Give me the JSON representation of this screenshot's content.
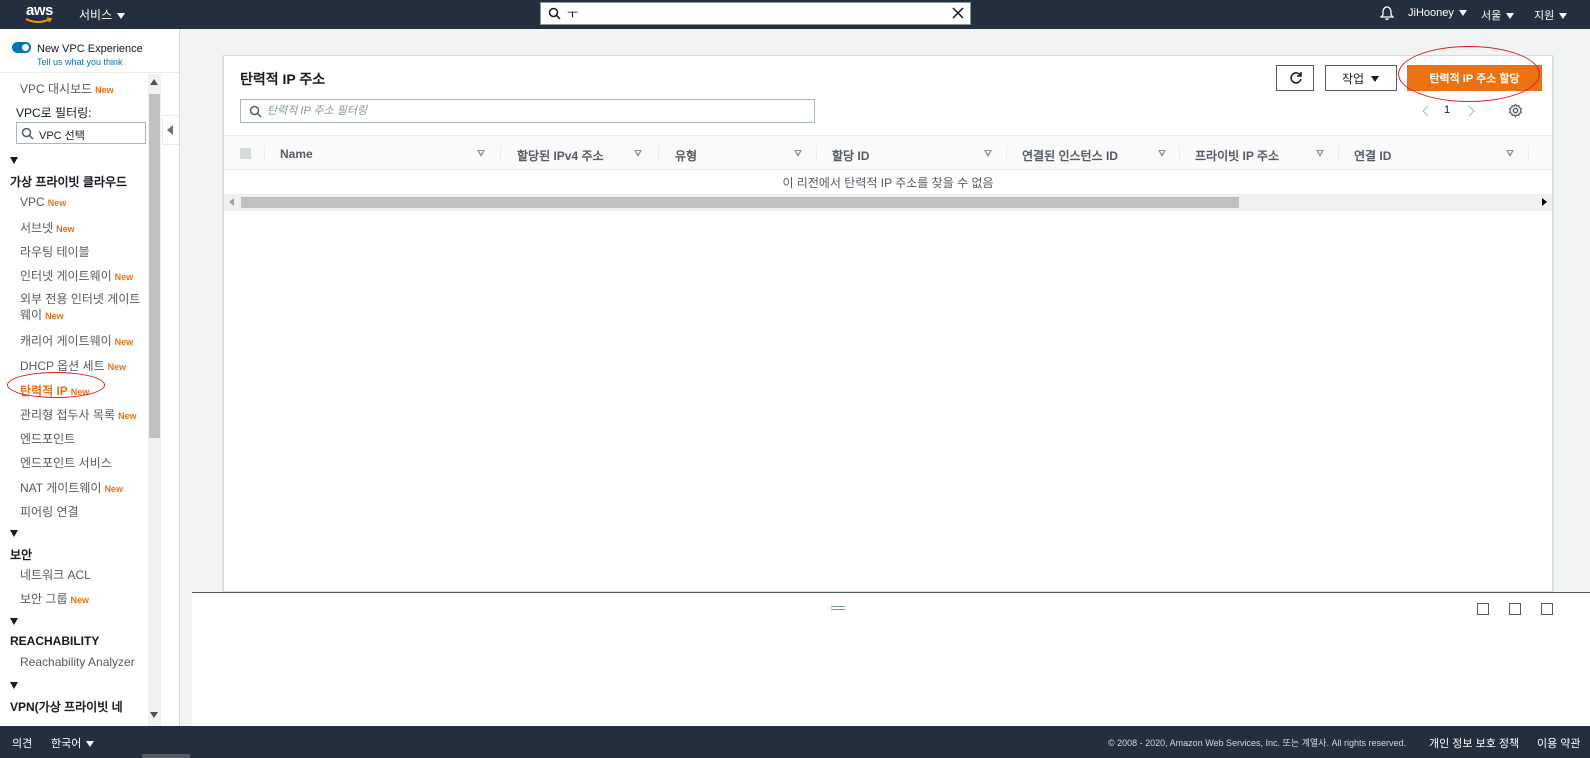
{
  "topnav": {
    "logo": "aws",
    "services": "서비스",
    "search_value": "ㅜ",
    "user": "JiHooney",
    "region": "서울",
    "support": "지원"
  },
  "sidebar": {
    "new_vpc_experience": "New VPC Experience",
    "tell_us": "Tell us what you think",
    "dashboard": "VPC 대시보드",
    "filter_label": "VPC로 필터링:",
    "filter_select": "VPC 선택",
    "new_badge": "New",
    "sections": [
      {
        "title": "가상 프라이빗 클라우드",
        "items": [
          {
            "label": "VPC",
            "new": true
          },
          {
            "label": "서브넷",
            "new": true
          },
          {
            "label": "라우팅 테이블",
            "new": false
          },
          {
            "label": "인터넷 게이트웨이",
            "new": true
          },
          {
            "label": "외부 전용 인터넷 게이트",
            "label2": "웨이",
            "new": true
          },
          {
            "label": "캐리어 게이트웨이",
            "new": true
          },
          {
            "label": "DHCP 옵션 세트",
            "new": true
          },
          {
            "label": "탄력적 IP",
            "new": true,
            "active": true
          },
          {
            "label": "관리형 접두사 목록",
            "new": true
          },
          {
            "label": "엔드포인트",
            "new": false
          },
          {
            "label": "엔드포인트 서비스",
            "new": false
          },
          {
            "label": "NAT 게이트웨이",
            "new": true
          },
          {
            "label": "피어링 연결",
            "new": false
          }
        ]
      },
      {
        "title": "보안",
        "items": [
          {
            "label": "네트워크 ACL",
            "new": false
          },
          {
            "label": "보안 그룹",
            "new": true
          }
        ]
      },
      {
        "title": "REACHABILITY",
        "items": [
          {
            "label": "Reachability Analyzer",
            "new": false
          }
        ]
      },
      {
        "title": "VPN(가상 프라이빗 네",
        "items": []
      }
    ]
  },
  "main": {
    "title": "탄력적 IP 주소",
    "actions_label": "작업",
    "allocate_label": "탄력적 IP 주소 할당",
    "filter_placeholder": "탄력적 IP 주소 필터링",
    "page_number": "1",
    "columns": [
      "Name",
      "할당된 IPv4 주소",
      "유형",
      "할당 ID",
      "연결된 인스턴스 ID",
      "프라이빗 IP 주소",
      "연결 ID"
    ],
    "empty_message": "이 리전에서 탄력적 IP 주소를 찾을 수 없음"
  },
  "footer": {
    "feedback": "의견",
    "language": "한국어",
    "copyright": "© 2008 - 2020, Amazon Web Services, Inc. 또는 계열사. All rights reserved.",
    "privacy": "개인 정보 보호 정책",
    "terms": "이용 약관"
  },
  "colors": {
    "nav_bg": "#232f3e",
    "accent_orange": "#ec7211",
    "link_blue": "#0073bb",
    "annotation_red": "#e01b22"
  }
}
